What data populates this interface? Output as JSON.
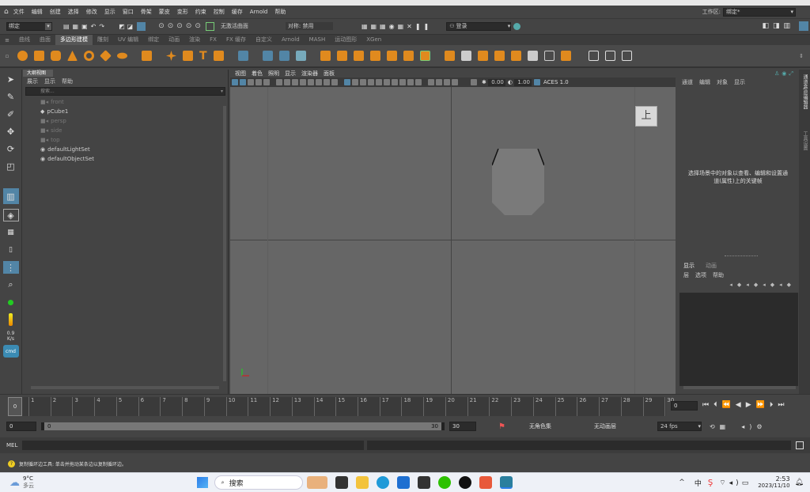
{
  "menubar": {
    "items": [
      "文件",
      "编辑",
      "创建",
      "选择",
      "修改",
      "显示",
      "窗口",
      "骨架",
      "蒙皮",
      "变形",
      "约束",
      "控制",
      "缓存",
      "Arnold",
      "帮助"
    ],
    "workspace_label": "工作区:",
    "workspace_value": "绑定*"
  },
  "statusline": {
    "mode_value": "绑定",
    "live_surface": "无激活曲面",
    "symmetry": "对称: 禁用",
    "login": "登录"
  },
  "shelf": {
    "tabs": [
      "曲线",
      "曲面",
      "多边形建模",
      "雕刻",
      "UV 编辑",
      "绑定",
      "动画",
      "渲染",
      "FX",
      "FX 缓存",
      "自定义",
      "Arnold",
      "MASH",
      "运动图形",
      "XGen"
    ],
    "active_tab": "多边形建模"
  },
  "toolbox": {
    "fps_value": "0.9",
    "fps_unit": "K/s"
  },
  "outliner": {
    "title": "大纲视图",
    "menu": [
      "展示",
      "显示",
      "帮助"
    ],
    "search_placeholder": "搜索...",
    "items": [
      {
        "label": "front",
        "dim": true
      },
      {
        "label": "pCube1",
        "dim": false
      },
      {
        "label": "persp",
        "dim": true
      },
      {
        "label": "side",
        "dim": true
      },
      {
        "label": "top",
        "dim": true
      },
      {
        "label": "defaultLightSet",
        "dim": false
      },
      {
        "label": "defaultObjectSet",
        "dim": false
      }
    ]
  },
  "viewport": {
    "menu": [
      "视图",
      "着色",
      "照明",
      "显示",
      "渲染器",
      "面板"
    ],
    "exposure": "0.00",
    "gamma": "1.00",
    "colorspace": "ACES 1.0",
    "view_cube_label": "上"
  },
  "channelbox": {
    "menu": [
      "通道",
      "编辑",
      "对象",
      "显示"
    ],
    "hint": "选择场景中的对象以查看、编辑和设置通道(属性)上的关键帧",
    "layer_tabs": [
      "显示",
      "动画"
    ],
    "layer_menu": [
      "层",
      "选项",
      "帮助"
    ]
  },
  "rightstrip": {
    "tab1": "通道盒/层编辑器",
    "tab2": "工具设置"
  },
  "timeslider": {
    "ticks": [
      "1",
      "2",
      "3",
      "4",
      "5",
      "6",
      "7",
      "8",
      "9",
      "10",
      "11",
      "12",
      "13",
      "14",
      "15",
      "16",
      "17",
      "18",
      "19",
      "20",
      "21",
      "22",
      "23",
      "24",
      "25",
      "26",
      "27",
      "28",
      "29",
      "30"
    ],
    "current_frame": "0",
    "frame_field": "0"
  },
  "rangeslider": {
    "start": "0",
    "inner_start": "0",
    "inner_end": "30",
    "end": "30",
    "character_set": "无角色集",
    "anim_layer": "无动画层",
    "fps": "24 fps"
  },
  "cmdline": {
    "label": "MEL"
  },
  "helpline": {
    "text": "复制循环边工具: 单击并拖动某条边以复制循环边。"
  },
  "taskbar": {
    "weather_temp": "9°C",
    "weather_desc": "多云",
    "search": "搜索",
    "time": "2:53",
    "date": "2023/11/10",
    "ime": "中"
  },
  "colors": {
    "accent": "#5285a6",
    "shelf_orange": "#e08a1e",
    "viewport_bg": "#666666"
  }
}
